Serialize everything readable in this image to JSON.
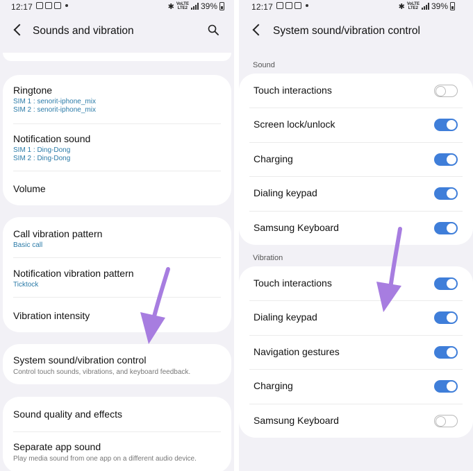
{
  "status_bar": {
    "time": "12:17",
    "battery": "39%"
  },
  "left_screen": {
    "title": "Sounds and vibration",
    "groups": {
      "ringtone": {
        "title": "Ringtone",
        "sim1": "SIM 1 : senorit-iphone_mix",
        "sim2": "SIM 2 : senorit-iphone_mix"
      },
      "notification_sound": {
        "title": "Notification sound",
        "sim1": "SIM 1 : Ding-Dong",
        "sim2": "SIM 2 : Ding-Dong"
      },
      "volume": {
        "title": "Volume"
      },
      "call_vibration": {
        "title": "Call vibration pattern",
        "value": "Basic call"
      },
      "notification_vibration": {
        "title": "Notification vibration pattern",
        "value": "Ticktock"
      },
      "vibration_intensity": {
        "title": "Vibration intensity"
      },
      "system_control": {
        "title": "System sound/vibration control",
        "desc": "Control touch sounds, vibrations, and keyboard feedback."
      },
      "sound_quality": {
        "title": "Sound quality and effects"
      },
      "separate_app_sound": {
        "title": "Separate app sound",
        "desc": "Play media sound from one app on a different audio device."
      }
    }
  },
  "right_screen": {
    "title": "System sound/vibration control",
    "sound_header": "Sound",
    "sound_items": [
      {
        "label": "Touch interactions",
        "on": false
      },
      {
        "label": "Screen lock/unlock",
        "on": true
      },
      {
        "label": "Charging",
        "on": true
      },
      {
        "label": "Dialing keypad",
        "on": true
      },
      {
        "label": "Samsung Keyboard",
        "on": true
      }
    ],
    "vibration_header": "Vibration",
    "vibration_items": [
      {
        "label": "Touch interactions",
        "on": true
      },
      {
        "label": "Dialing keypad",
        "on": true
      },
      {
        "label": "Navigation gestures",
        "on": true
      },
      {
        "label": "Charging",
        "on": true
      },
      {
        "label": "Samsung Keyboard",
        "on": false
      }
    ]
  },
  "colors": {
    "accent": "#3f7ed9",
    "sub_text": "#2b7ba8",
    "background": "#f2f1f6",
    "arrow": "#a77de0"
  }
}
